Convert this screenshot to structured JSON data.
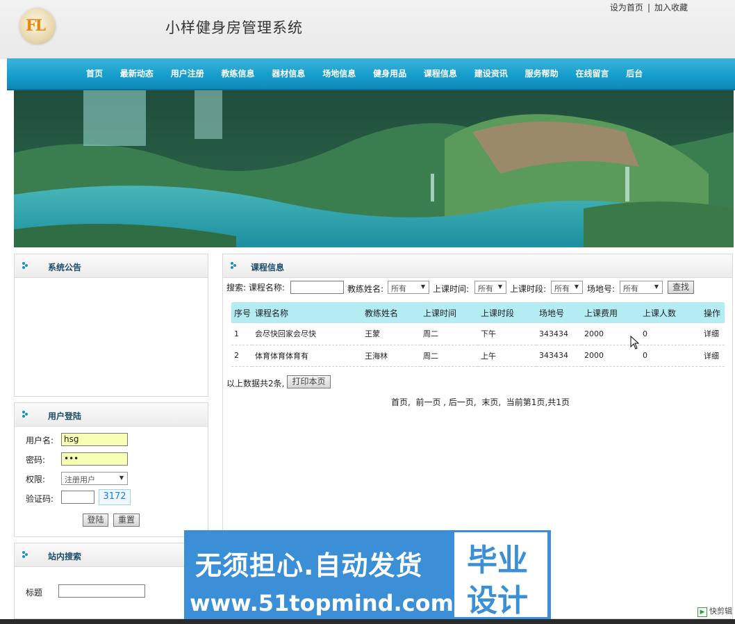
{
  "header": {
    "site_title": "小样健身房管理系统",
    "logo_text": "FL",
    "links": [
      "设为首页",
      "加入收藏"
    ],
    "link_sep": "|"
  },
  "nav": [
    "首页",
    "最新动态",
    "用户注册",
    "教练信息",
    "器材信息",
    "场地信息",
    "健身用品",
    "课程信息",
    "建设资讯",
    "服务帮助",
    "在线留言",
    "后台"
  ],
  "notice": {
    "title": "系统公告"
  },
  "login": {
    "title": "用户登陆",
    "username_label": "用户名:",
    "username_value": "hsg",
    "password_label": "密码:",
    "password_value": "•••",
    "role_label": "权限:",
    "role_value": "注册用户",
    "captcha_label": "验证码:",
    "captcha_value": "",
    "captcha_code": "3172",
    "login_btn": "登陆",
    "reset_btn": "重置"
  },
  "site_search": {
    "title": "站内搜索",
    "label": "标题",
    "value": ""
  },
  "main": {
    "title": "课程信息",
    "search": {
      "prefix": "搜索:",
      "course_label": "课程名称:",
      "course_value": "",
      "coach_label": "教练姓名:",
      "coach_value": "所有",
      "time_label": "上课时间:",
      "time_value": "所有",
      "slot_label": "上课时段:",
      "slot_value": "所有",
      "venue_label": "场地号:",
      "venue_value": "所有",
      "btn": "查找"
    },
    "columns": [
      "序号",
      "课程名称",
      "教练姓名",
      "上课时间",
      "上课时段",
      "场地号",
      "上课费用",
      "上课人数",
      "操作"
    ],
    "rows": [
      [
        "1",
        "会尽快回家会尽快",
        "王蒙",
        "周二",
        "下午",
        "343434",
        "2000",
        "0",
        "详细"
      ],
      [
        "2",
        "体育体育体育有",
        "王海林",
        "周二",
        "上午",
        "343434",
        "2000",
        "0",
        "详细"
      ]
    ],
    "summary": "以上数据共2条,",
    "print_btn": "打印本页",
    "pager": "首页,  前一页 , 后一页,  末页,  当前第1页,共1页"
  },
  "watermark": {
    "line1": "无须担心.自动发货",
    "line2": "www.51topmind.com",
    "box1": "毕业",
    "box2": "设计"
  },
  "corner_app": "快剪辑"
}
